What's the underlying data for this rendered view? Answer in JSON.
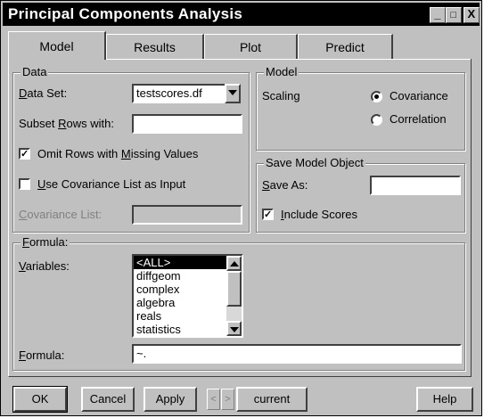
{
  "window": {
    "title": "Principal Components Analysis"
  },
  "title_buttons": {
    "minimize": "_",
    "maximize": "□",
    "close": "X"
  },
  "tabs": [
    {
      "label": "Model",
      "active": true
    },
    {
      "label": "Results",
      "active": false
    },
    {
      "label": "Plot",
      "active": false
    },
    {
      "label": "Predict",
      "active": false
    }
  ],
  "data_group": {
    "title": "Data",
    "data_set_label": "Data Set:",
    "data_set_value": "testscores.df",
    "subset_label": "Subset Rows with:",
    "subset_value": "",
    "omit_label": "Omit Rows with Missing Values",
    "omit_checked": true,
    "cov_list_input_label": "Use Covariance List as Input",
    "cov_list_input_checked": false,
    "cov_list_label": "Covariance List:",
    "cov_list_value": ""
  },
  "model_group": {
    "title": "Model",
    "scaling_label": "Scaling",
    "options": [
      {
        "label": "Covariance",
        "selected": true
      },
      {
        "label": "Correlation",
        "selected": false
      }
    ]
  },
  "save_group": {
    "title": "Save Model Object",
    "save_as_label": "Save As:",
    "save_as_value": "",
    "include_scores_label": "Include Scores",
    "include_scores_checked": true
  },
  "formula_group": {
    "title": "Formula:",
    "variables_label": "Variables:",
    "variables": [
      "<ALL>",
      "diffgeom",
      "complex",
      "algebra",
      "reals",
      "statistics"
    ],
    "selected_variable": "<ALL>",
    "formula_label": "Formula:",
    "formula_value": "~."
  },
  "footer": {
    "ok": "OK",
    "cancel": "Cancel",
    "apply": "Apply",
    "prev": "<",
    "next": ">",
    "current": "current",
    "help": "Help"
  },
  "colors": {
    "title_bg": "#000000",
    "dialog_bg": "#c0c0c0",
    "selection_bg": "#000000"
  },
  "icons": [
    "minimize-icon",
    "maximize-icon",
    "close-icon",
    "chevron-down-icon",
    "chevron-up-icon",
    "checkmark-icon",
    "radio-dot-icon"
  ]
}
